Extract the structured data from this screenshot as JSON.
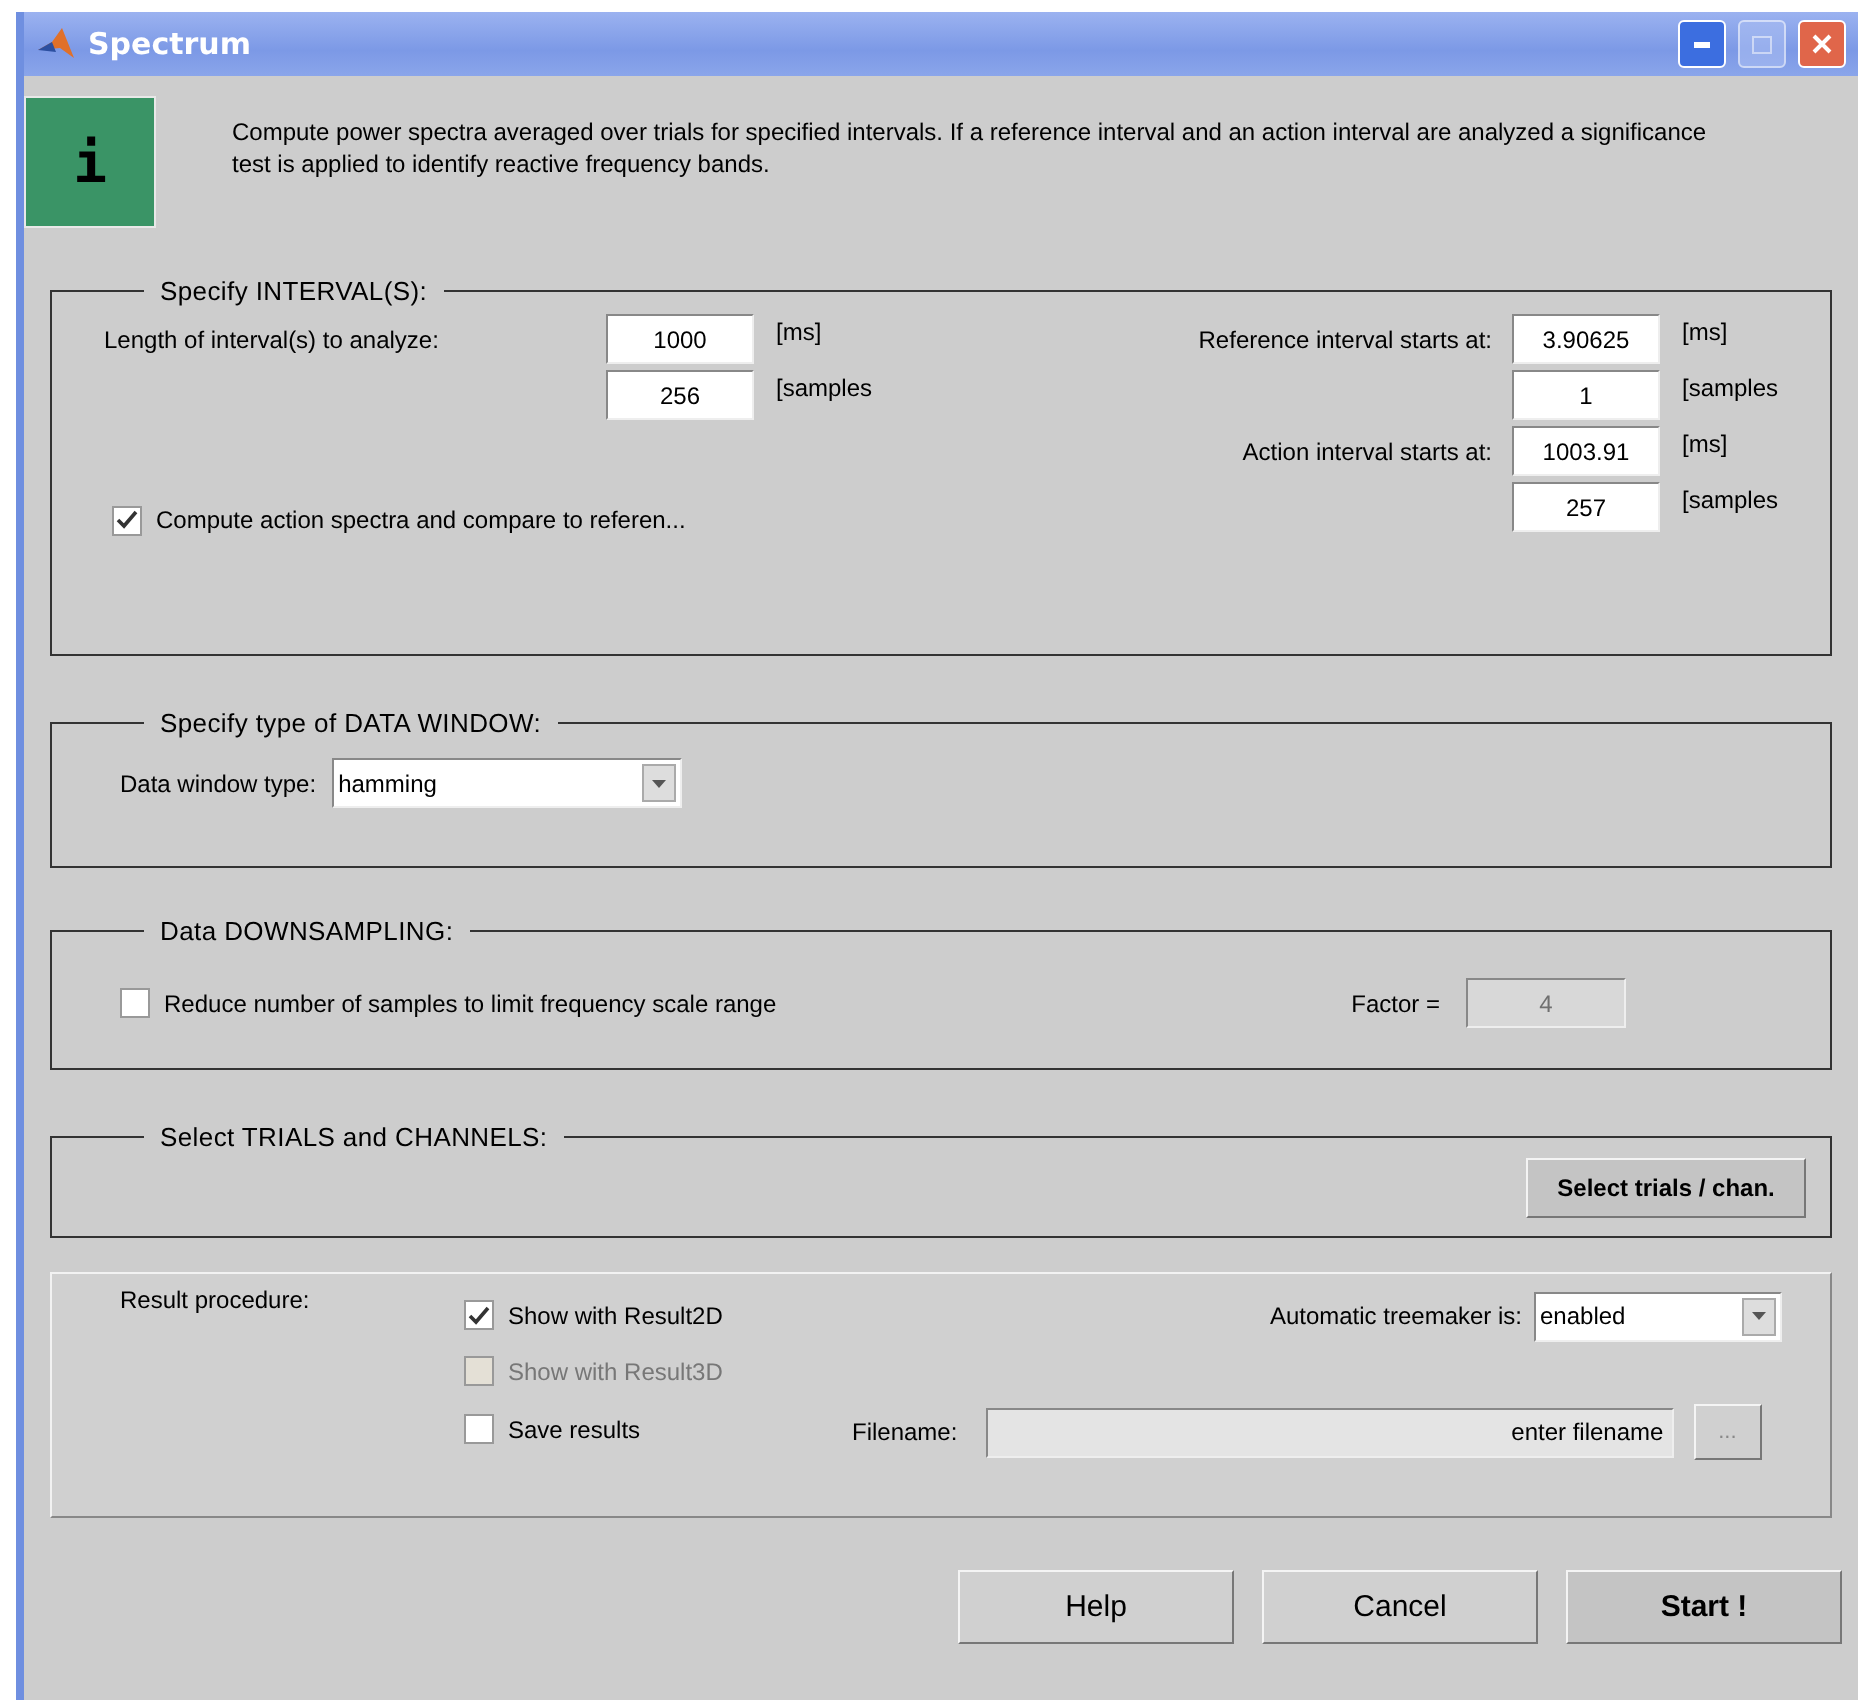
{
  "window": {
    "title": "Spectrum"
  },
  "info": {
    "glyph": "i",
    "text": "Compute power spectra averaged over trials for specified intervals. If a reference interval and an action interval are analyzed a significance test is applied to identify reactive frequency bands."
  },
  "interval": {
    "title": "Specify INTERVAL(S):",
    "length": {
      "label": "Length of interval(s) to analyze:",
      "ms": "1000",
      "ms_unit": "[ms]",
      "samples": "256",
      "samples_unit": "[samples"
    },
    "reference": {
      "label": "Reference interval starts at:",
      "ms": "3.90625",
      "ms_unit": "[ms]",
      "samples": "1",
      "samples_unit": "[samples"
    },
    "action": {
      "label": "Action interval starts at:",
      "ms": "1003.91",
      "ms_unit": "[ms]",
      "samples": "257",
      "samples_unit": "[samples"
    },
    "compare": {
      "label": "Compute action spectra and compare to referen...",
      "checked": true
    }
  },
  "data_window": {
    "title": "Specify type of DATA WINDOW:",
    "label": "Data window type:",
    "value": "hamming"
  },
  "downsampling": {
    "title": "Data DOWNSAMPLING:",
    "reduce": {
      "label": "Reduce number of samples to limit frequency scale range",
      "checked": false
    },
    "factor": {
      "label": "Factor =",
      "value": "4",
      "disabled": true
    }
  },
  "trials": {
    "title": "Select TRIALS and CHANNELS:",
    "button": "Select trials / chan."
  },
  "results": {
    "label": "Result procedure:",
    "options": [
      {
        "label": "Show with Result2D",
        "checked": true,
        "disabled": false
      },
      {
        "label": "Show with Result3D",
        "checked": false,
        "disabled": true
      },
      {
        "label": "Save results",
        "checked": false,
        "disabled": false
      }
    ],
    "treemaker": {
      "label": "Automatic treemaker is:",
      "value": "enabled"
    },
    "filename": {
      "label": "Filename:",
      "placeholder": "enter filename"
    },
    "browse": "..."
  },
  "buttons": [
    {
      "label": "Help",
      "primary": false
    },
    {
      "label": "Cancel",
      "primary": false
    },
    {
      "label": "Start !",
      "primary": true
    }
  ]
}
